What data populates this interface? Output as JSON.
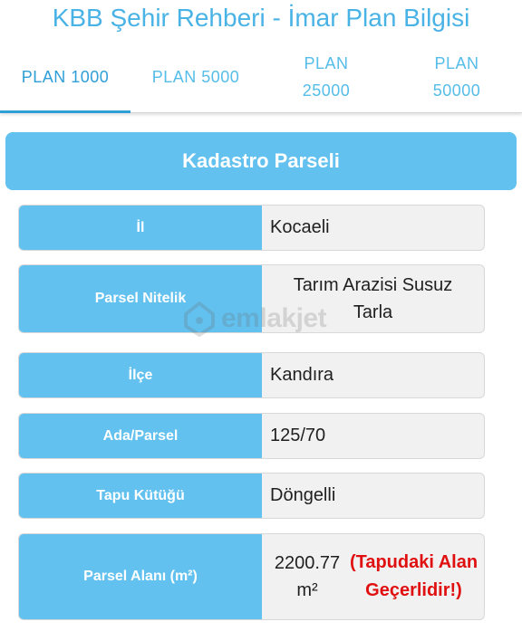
{
  "app_title": "KBB Şehir Rehberi - İmar Plan Bilgisi",
  "tabs": [
    {
      "line1": "PLAN 1000",
      "line2": "",
      "active": true
    },
    {
      "line1": "PLAN 5000",
      "line2": "",
      "active": false
    },
    {
      "line1": "PLAN",
      "line2": "25000",
      "active": false
    },
    {
      "line1": "PLAN",
      "line2": "50000",
      "active": false
    }
  ],
  "section_title": "Kadastro Parseli",
  "rows": {
    "il": {
      "label": "İl",
      "value": "Kocaeli"
    },
    "parsel_nitelik": {
      "label": "Parsel Nitelik",
      "value": "Tarım Arazisi Susuz Tarla"
    },
    "ilce": {
      "label": "İlçe",
      "value": "Kandıra"
    },
    "ada_parsel": {
      "label": "Ada/Parsel",
      "value": "125/70"
    },
    "tapu_kutugu": {
      "label": "Tapu Kütüğü",
      "value": "Döngelli"
    },
    "parsel_alani": {
      "label": "Parsel Alanı (m²)",
      "value": "2200.77 m²",
      "note": "(Tapudaki Alan Geçerlidir!)"
    }
  },
  "watermark": {
    "text": "emlakjet",
    "icon": "house-pin-icon"
  },
  "colors": {
    "accent": "#62c1ef",
    "tab_text": "#55bde9",
    "warning": "#e01010"
  }
}
